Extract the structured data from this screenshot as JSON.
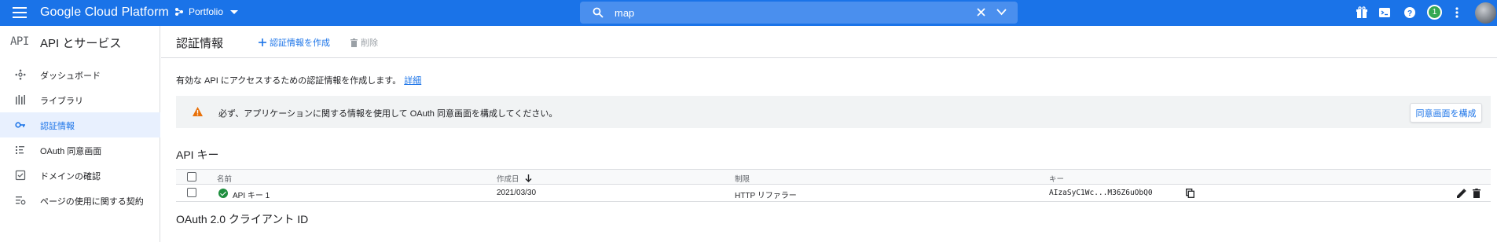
{
  "topbar": {
    "app_title": "Google Cloud Platform",
    "project_name": "Portfolio",
    "search_value": "map",
    "notification_count": "1",
    "colors": {
      "bar": "#1a73e8",
      "search_bg": "#4a8fee",
      "badge": "#34a853"
    },
    "icons": [
      "menu-icon",
      "project-icon",
      "search-icon",
      "clear-icon",
      "expand-icon",
      "gift-icon",
      "cloud-shell-icon",
      "help-icon",
      "more-vert-icon",
      "avatar"
    ]
  },
  "sidebar": {
    "logo": "API",
    "title": "API とサービス",
    "items": [
      {
        "label": "ダッシュボード",
        "icon": "dashboard-icon"
      },
      {
        "label": "ライブラリ",
        "icon": "library-icon"
      },
      {
        "label": "認証情報",
        "icon": "key-icon",
        "active": true
      },
      {
        "label": "OAuth 同意画面",
        "icon": "consent-icon"
      },
      {
        "label": "ドメインの確認",
        "icon": "domain-check-icon"
      },
      {
        "label": "ページの使用に関する契約",
        "icon": "agreement-icon"
      }
    ]
  },
  "main": {
    "title": "認証情報",
    "create_label": "認証情報を作成",
    "delete_label": "削除",
    "description": "有効な API にアクセスするための認証情報を作成します。",
    "details_link": "詳細",
    "banner": {
      "text": "必ず、アプリケーションに関する情報を使用して OAuth 同意画面を構成してください。",
      "button": "同意画面を構成"
    },
    "api_keys": {
      "title": "API キー",
      "columns": [
        "名前",
        "作成日",
        "制限",
        "キー"
      ],
      "rows": [
        {
          "name": "API キー 1",
          "created": "2021/03/30",
          "restriction": "HTTP リファラー",
          "key": "AIzaSyC1Wc...M36Z6uObQ0"
        }
      ]
    },
    "oauth_title": "OAuth 2.0 クライアント ID"
  }
}
